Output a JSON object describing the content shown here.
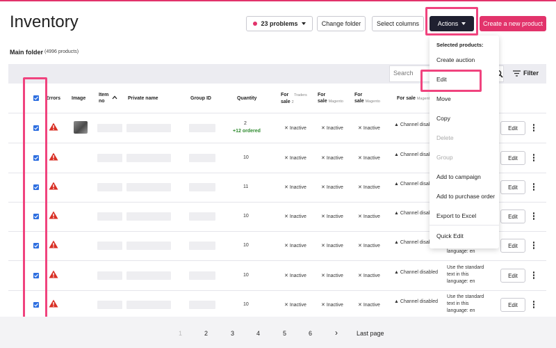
{
  "header": {
    "title": "Inventory",
    "problems_label": "23 problems",
    "change_folder_label": "Change folder",
    "select_columns_label": "Select columns",
    "actions_label": "Actions",
    "create_product_label": "Create a new product"
  },
  "folder": {
    "name": "Main folder",
    "count": "(4996 products)"
  },
  "search": {
    "placeholder": "Search",
    "filter_label": "Filter"
  },
  "columns": {
    "errors": "Errors",
    "image": "Image",
    "item_no_line1": "Item",
    "item_no_line2": "no",
    "private_name": "Private name",
    "group_id": "Group ID",
    "quantity": "Quantity",
    "for_sale_1": "For",
    "for_sale_2": "sale",
    "traders_a": "Traders",
    "traders_b": "2",
    "magento": "Magento",
    "for_sale_single": "For sale"
  },
  "rows": [
    {
      "quantity": "2",
      "ordered": "+12 ordered",
      "status": "Inactive",
      "channel": "Channel disab",
      "desc_1": "",
      "desc_2": "",
      "desc_3": ""
    },
    {
      "quantity": "10",
      "status": "Inactive",
      "channel": "Channel disab"
    },
    {
      "quantity": "11",
      "status": "Inactive",
      "channel": "Channel disab"
    },
    {
      "quantity": "10",
      "status": "Inactive",
      "channel": "Channel disab"
    },
    {
      "quantity": "10",
      "status": "Inactive",
      "channel": "Channel disab",
      "desc_3": "language: en"
    },
    {
      "quantity": "10",
      "status": "Inactive",
      "channel": "Channel disabled",
      "desc_1": "Use the standard",
      "desc_2": "text in this",
      "desc_3": "language: en"
    },
    {
      "quantity": "10",
      "status": "Inactive",
      "channel": "Channel disabled",
      "desc_1": "Use the standard",
      "desc_2": "text in this",
      "desc_3": "language: en"
    }
  ],
  "row_actions": {
    "edit_label": "Edit"
  },
  "actions_menu": {
    "heading": "Selected products:",
    "items": [
      "Create auction",
      "Edit",
      "Move",
      "Copy",
      "Delete",
      "Group",
      "Add to campaign",
      "Add to purchase order",
      "Export to Excel",
      "Quick Edit"
    ]
  },
  "pagination": {
    "pages": [
      "1",
      "2",
      "3",
      "4",
      "5",
      "6"
    ],
    "next": "›",
    "last": "Last page"
  },
  "colors": {
    "accent": "#e2336b",
    "dark_button": "#1f2030",
    "checkbox": "#2e6fe0",
    "warning": "#d93025",
    "highlight": "#f0437e"
  }
}
